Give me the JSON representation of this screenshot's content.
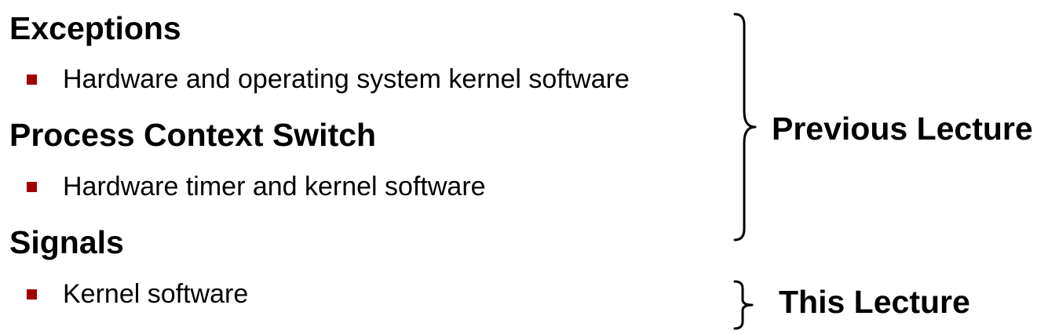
{
  "sections": [
    {
      "heading": "Exceptions",
      "bullet": "Hardware and operating system kernel software"
    },
    {
      "heading": "Process Context Switch",
      "bullet": "Hardware timer and kernel software"
    },
    {
      "heading": "Signals",
      "bullet": "Kernel software"
    }
  ],
  "annotations": {
    "previous": "Previous Lecture",
    "current": "This Lecture"
  },
  "colors": {
    "bullet": "#a00000",
    "text": "#000000"
  }
}
